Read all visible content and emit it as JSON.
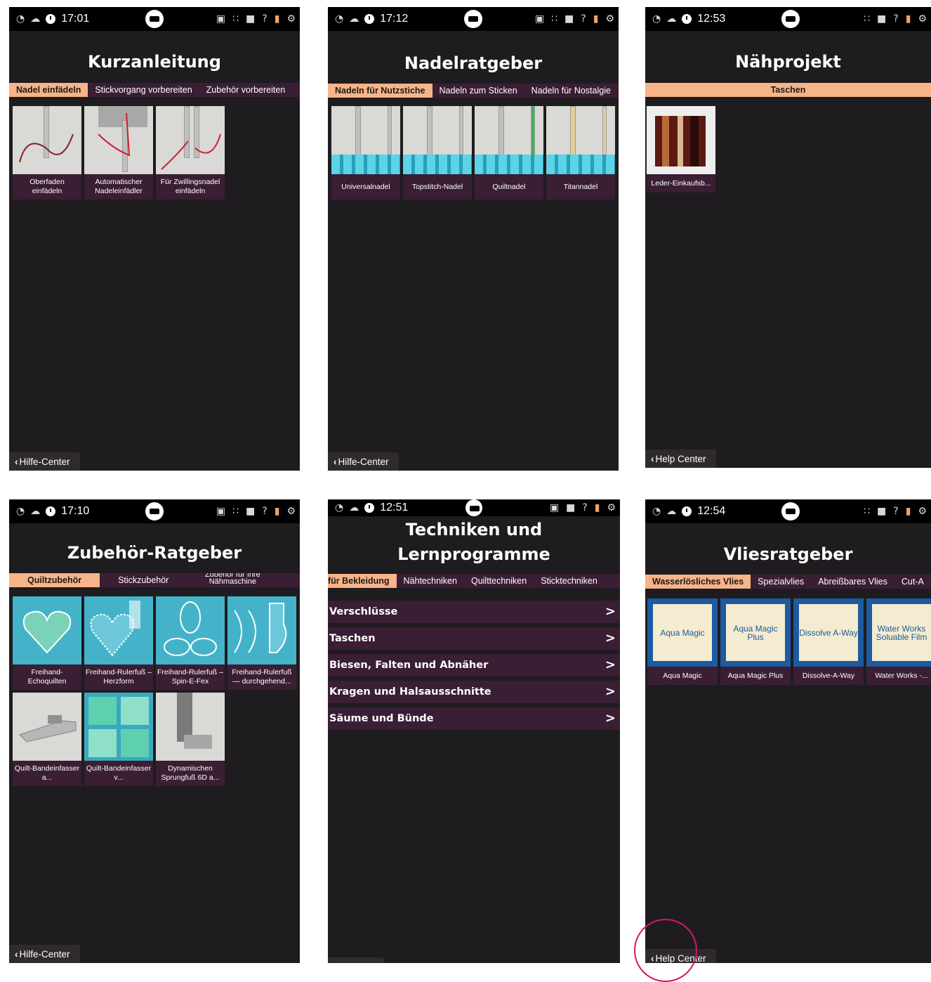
{
  "status_icons": [
    "wifi-icon",
    "cloud-icon",
    "clock-icon",
    "machine-icon",
    "screen-icon",
    "bluetooth-icon",
    "book-icon",
    "help-icon",
    "notebook-icon",
    "gear-icon"
  ],
  "colors": {
    "panel_bg": "#1f1c1f",
    "tab_bar": "#3a1e34",
    "tab_active": "#f7b488",
    "status_bar": "#000000",
    "circle": "#d0186a"
  },
  "panels": [
    {
      "time": "17:01",
      "title": "Kurzanleitung",
      "tabs": [
        "Nadel einfädeln",
        "Stickvorgang vorbereiten",
        "Zubehör vorbereiten"
      ],
      "tiles": [
        "Oberfaden einfädeln",
        "Automatischer Nadeleinfädler",
        "Für Zwillingsnadel einfädeln"
      ],
      "back": "Hilfe-Center"
    },
    {
      "time": "17:12",
      "title": "Nadelratgeber",
      "tabs": [
        "Nadeln für Nutzstiche",
        "Nadeln zum Sticken",
        "Nadeln für Nostalgie"
      ],
      "tiles": [
        "Universalnadel",
        "Topstitch-Nadel",
        "Quiltnadel",
        "Titannadel"
      ],
      "back": "Hilfe-Center"
    },
    {
      "time": "12:53",
      "title": "Nähprojekt",
      "tabs": [
        "Taschen"
      ],
      "tiles": [
        "Leder-Einkaufsb..."
      ],
      "back": "Help Center"
    },
    {
      "time": "17:10",
      "title": "Zubehör-Ratgeber",
      "tabs": [
        "Quiltzubehör",
        "Stickzubehör",
        "Zubehör für Ihre Nähmaschine"
      ],
      "tiles": [
        "Freihand-Echoquilten",
        "Freihand-Rulerfuß – Herzform",
        "Freihand-Rulerfuß – Spin-E-Fex",
        "Freihand-Rulerfuß — durchgehend...",
        "Quilt-Bandeinfasser a...",
        "Quilt-Bandeinfasser v...",
        "Dynamischen Sprungfuß 6D a..."
      ],
      "back": "Hilfe-Center"
    },
    {
      "time": "12:51",
      "title_line1": "Techniken und",
      "title_line2": "Lernprogramme",
      "tabs": [
        "für Bekleidung",
        "Nähtechniken",
        "Quilttechniken",
        "Sticktechniken"
      ],
      "rows": [
        "Verschlüsse",
        "Taschen",
        "Biesen, Falten und Abnäher",
        "Kragen und Halsausschnitte",
        "Säume und Bünde"
      ],
      "chevron": ">"
    },
    {
      "time": "12:54",
      "title": "Vliesratgeber",
      "tabs": [
        "Wasserlösliches Vlies",
        "Spezialvlies",
        "Abreißbares Vlies",
        "Cut-A"
      ],
      "thumb_labels": [
        "Aqua Magic",
        "Aqua Magic Plus",
        "Dissolve A-Way",
        "Water Works Soluable Film"
      ],
      "tiles": [
        "Aqua Magic",
        "Aqua Magic Plus",
        "Dissolve-A-Way",
        "Water Works -..."
      ],
      "back": "Help Center"
    }
  ]
}
